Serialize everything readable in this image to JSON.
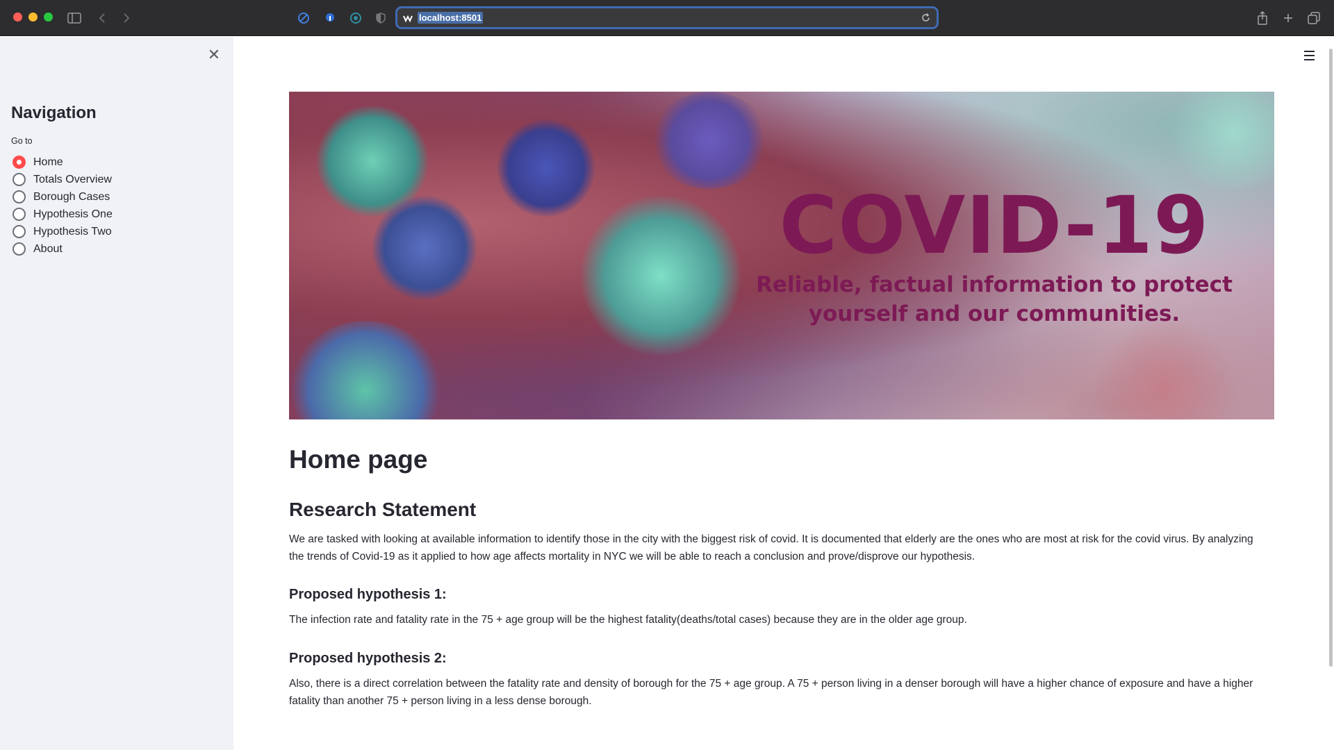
{
  "browser": {
    "url": "localhost:8501"
  },
  "sidebar": {
    "title": "Navigation",
    "goto_label": "Go to",
    "options": [
      {
        "label": "Home",
        "selected": true
      },
      {
        "label": "Totals Overview",
        "selected": false
      },
      {
        "label": "Borough Cases",
        "selected": false
      },
      {
        "label": "Hypothesis One",
        "selected": false
      },
      {
        "label": "Hypothesis Two",
        "selected": false
      },
      {
        "label": "About",
        "selected": false
      }
    ],
    "close_icon": "close-icon"
  },
  "banner": {
    "title": "COVID-19",
    "subtitle_line1": "Reliable, factual information to protect",
    "subtitle_line2": "yourself and our communities."
  },
  "main": {
    "page_title": "Home page",
    "section_title": "Research Statement",
    "research_text": "We are tasked with looking at available information to identify those in the city with the biggest risk of covid. It is documented that elderly are the ones who are most at risk for the covid virus. By analyzing the trends of Covid-19 as it applied to how age affects mortality in NYC we will be able to reach a conclusion and prove/disprove our hypothesis.",
    "hypothesis1_title": "Proposed hypothesis 1:",
    "hypothesis1_text": "The infection rate and fatality rate in the 75 + age group will be the highest fatality(deaths/total cases) because they are in the older age group.",
    "hypothesis2_title": "Proposed hypothesis 2:",
    "hypothesis2_text": "Also, there is a direct correlation between the fatality rate and density of borough for the 75 + age group. A 75 + person living in a denser borough will have a higher chance of exposure and have a higher fatality than another 75 + person living in a less dense borough."
  },
  "colors": {
    "accent": "#ff4b4b",
    "sidebar_bg": "#f0f2f6",
    "banner_text": "#7d1a55"
  }
}
